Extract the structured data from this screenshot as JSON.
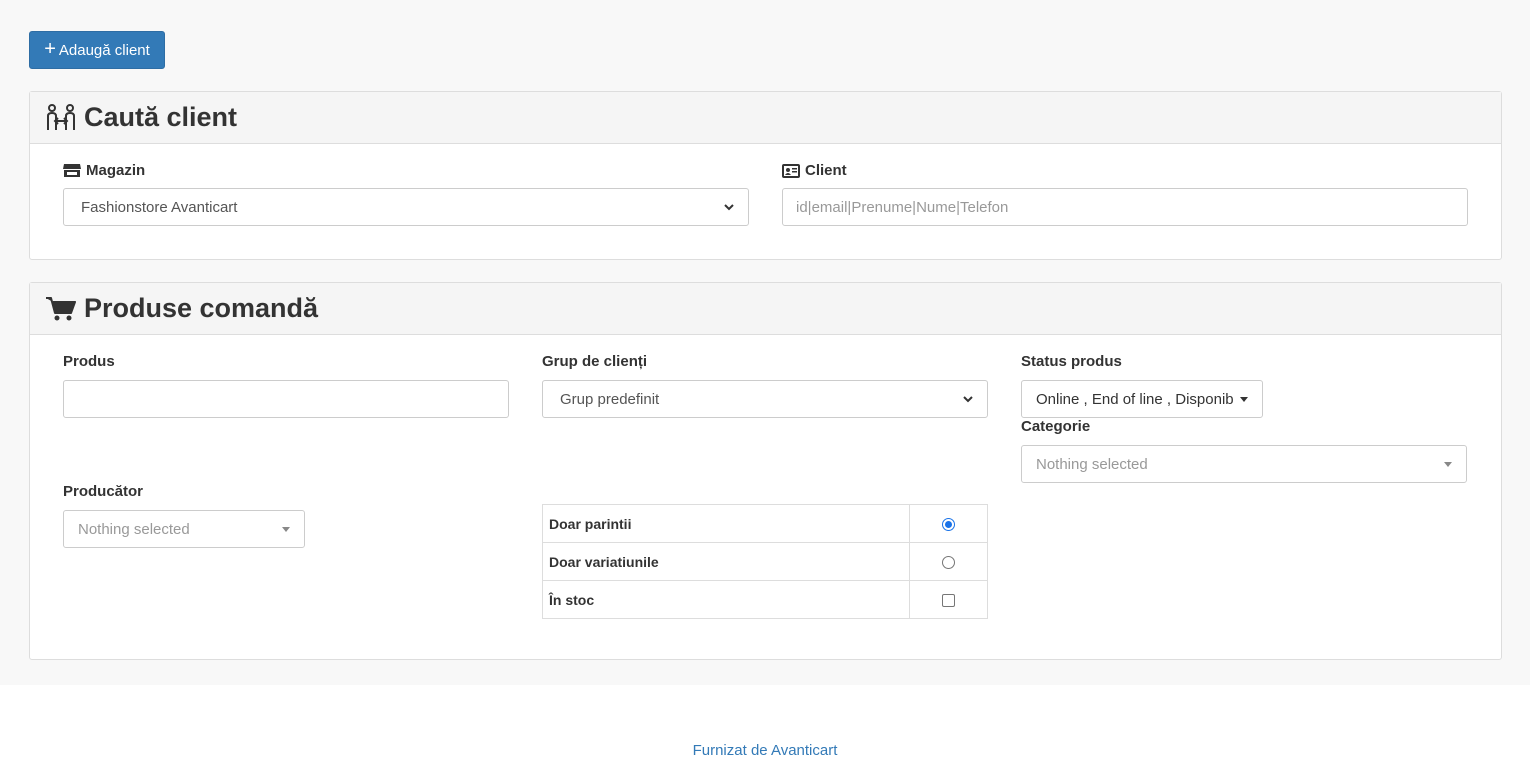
{
  "toolbar": {
    "add_client_label": "Adaugă client",
    "add_icon": "plus-icon"
  },
  "search_panel": {
    "title": "Caută client",
    "title_icon": "people-arrows-icon",
    "store": {
      "label": "Magazin",
      "icon": "store-icon",
      "value": "Fashionstore Avanticart"
    },
    "client": {
      "label": "Client",
      "icon": "id-card-icon",
      "placeholder": "id|email|Prenume|Nume|Telefon"
    }
  },
  "products_panel": {
    "title": "Produse comandă",
    "title_icon": "shopping-cart-icon",
    "product": {
      "label": "Produs",
      "value": ""
    },
    "customer_group": {
      "label": "Grup de clienți",
      "value": "Grup predefinit"
    },
    "product_status": {
      "label": "Status produs",
      "value": "Online , End of line , Disponibil"
    },
    "category": {
      "label": "Categorie",
      "value": "Nothing selected"
    },
    "manufacturer": {
      "label": "Producător",
      "value": "Nothing selected"
    },
    "options": [
      {
        "label": "Doar parintii",
        "control": "radio",
        "checked": true
      },
      {
        "label": "Doar variatiunile",
        "control": "radio",
        "checked": false
      },
      {
        "label": "În stoc",
        "control": "checkbox",
        "checked": false
      }
    ]
  },
  "footer": {
    "text": "Furnizat de Avanticart"
  },
  "colors": {
    "primary": "#337ab7",
    "panel_heading_bg": "#f5f5f5",
    "page_bg": "#f8f8f8"
  }
}
